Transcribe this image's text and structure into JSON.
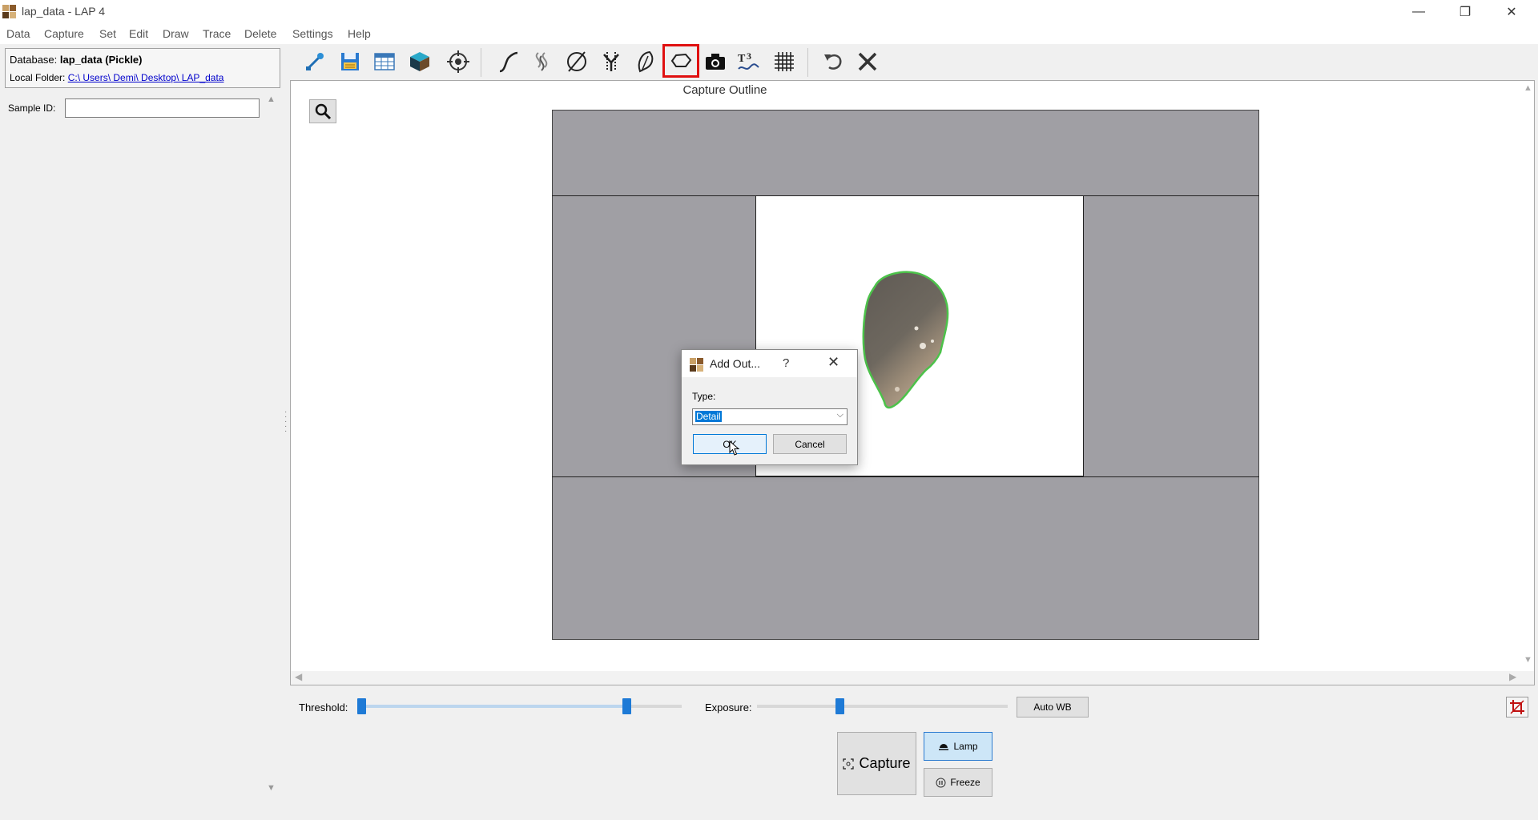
{
  "window": {
    "title": "lap_data - LAP 4",
    "minimize": "—",
    "maximize": "❐",
    "close": "✕"
  },
  "menu": [
    "Data",
    "Capture",
    "Set",
    "Edit",
    "Draw",
    "Trace",
    "Delete",
    "Settings",
    "Help"
  ],
  "left_panel": {
    "database_label": "Database:",
    "database_name": "lap_data (Pickle)",
    "folder_label": "Local Folder:",
    "folder_path": "C:\\ Users\\ Demi\\ Desktop\\ LAP_data",
    "sample_id_label": "Sample ID:",
    "sample_id_value": ""
  },
  "toolbar": {
    "icons": [
      "connect-icon",
      "save-icon",
      "table-icon",
      "cube-icon",
      "target-icon",
      "curve-icon",
      "spiral-icon",
      "null-circle-icon",
      "split-line-icon",
      "leaf-icon",
      "outline-icon",
      "camera-icon",
      "text-trace-icon",
      "grid-icon",
      "undo-icon",
      "delete-icon"
    ],
    "selected": "outline-icon"
  },
  "canvas": {
    "title": "Capture Outline"
  },
  "controls": {
    "threshold_label": "Threshold:",
    "threshold_low": 0.0,
    "threshold_high": 0.83,
    "exposure_label": "Exposure:",
    "exposure_value": 0.33,
    "auto_wb_label": "Auto WB",
    "capture_label": "Capture",
    "lamp_label": "Lamp",
    "freeze_label": "Freeze"
  },
  "dialog": {
    "title": "Add Out...",
    "help": "?",
    "close": "✕",
    "type_label": "Type:",
    "type_value": "Detail",
    "ok_label": "OK",
    "cancel_label": "Cancel"
  },
  "colors": {
    "accent": "#1e7ad6",
    "selection_box": "#e01010",
    "image_background": "#a09fa4",
    "outline_trace": "#4cc24a"
  }
}
